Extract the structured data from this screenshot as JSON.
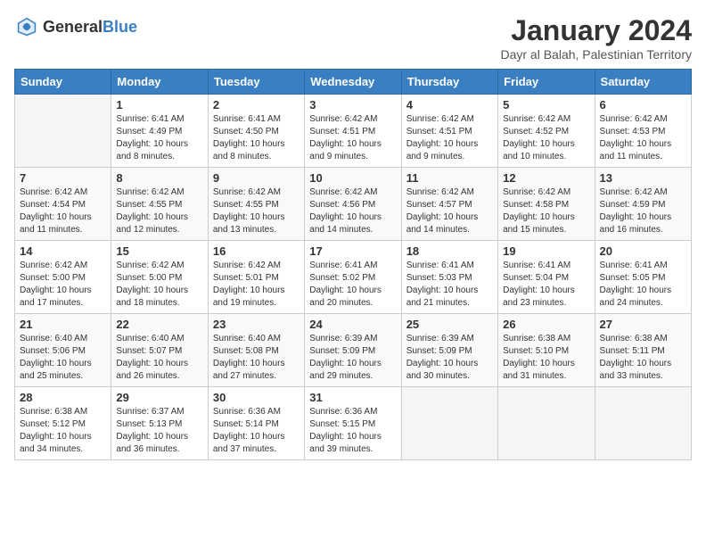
{
  "header": {
    "logo_general": "General",
    "logo_blue": "Blue",
    "title": "January 2024",
    "location": "Dayr al Balah, Palestinian Territory"
  },
  "weekdays": [
    "Sunday",
    "Monday",
    "Tuesday",
    "Wednesday",
    "Thursday",
    "Friday",
    "Saturday"
  ],
  "weeks": [
    [
      {
        "day": "",
        "info": ""
      },
      {
        "day": "1",
        "info": "Sunrise: 6:41 AM\nSunset: 4:49 PM\nDaylight: 10 hours\nand 8 minutes."
      },
      {
        "day": "2",
        "info": "Sunrise: 6:41 AM\nSunset: 4:50 PM\nDaylight: 10 hours\nand 8 minutes."
      },
      {
        "day": "3",
        "info": "Sunrise: 6:42 AM\nSunset: 4:51 PM\nDaylight: 10 hours\nand 9 minutes."
      },
      {
        "day": "4",
        "info": "Sunrise: 6:42 AM\nSunset: 4:51 PM\nDaylight: 10 hours\nand 9 minutes."
      },
      {
        "day": "5",
        "info": "Sunrise: 6:42 AM\nSunset: 4:52 PM\nDaylight: 10 hours\nand 10 minutes."
      },
      {
        "day": "6",
        "info": "Sunrise: 6:42 AM\nSunset: 4:53 PM\nDaylight: 10 hours\nand 11 minutes."
      }
    ],
    [
      {
        "day": "7",
        "info": "Sunrise: 6:42 AM\nSunset: 4:54 PM\nDaylight: 10 hours\nand 11 minutes."
      },
      {
        "day": "8",
        "info": "Sunrise: 6:42 AM\nSunset: 4:55 PM\nDaylight: 10 hours\nand 12 minutes."
      },
      {
        "day": "9",
        "info": "Sunrise: 6:42 AM\nSunset: 4:55 PM\nDaylight: 10 hours\nand 13 minutes."
      },
      {
        "day": "10",
        "info": "Sunrise: 6:42 AM\nSunset: 4:56 PM\nDaylight: 10 hours\nand 14 minutes."
      },
      {
        "day": "11",
        "info": "Sunrise: 6:42 AM\nSunset: 4:57 PM\nDaylight: 10 hours\nand 14 minutes."
      },
      {
        "day": "12",
        "info": "Sunrise: 6:42 AM\nSunset: 4:58 PM\nDaylight: 10 hours\nand 15 minutes."
      },
      {
        "day": "13",
        "info": "Sunrise: 6:42 AM\nSunset: 4:59 PM\nDaylight: 10 hours\nand 16 minutes."
      }
    ],
    [
      {
        "day": "14",
        "info": "Sunrise: 6:42 AM\nSunset: 5:00 PM\nDaylight: 10 hours\nand 17 minutes."
      },
      {
        "day": "15",
        "info": "Sunrise: 6:42 AM\nSunset: 5:00 PM\nDaylight: 10 hours\nand 18 minutes."
      },
      {
        "day": "16",
        "info": "Sunrise: 6:42 AM\nSunset: 5:01 PM\nDaylight: 10 hours\nand 19 minutes."
      },
      {
        "day": "17",
        "info": "Sunrise: 6:41 AM\nSunset: 5:02 PM\nDaylight: 10 hours\nand 20 minutes."
      },
      {
        "day": "18",
        "info": "Sunrise: 6:41 AM\nSunset: 5:03 PM\nDaylight: 10 hours\nand 21 minutes."
      },
      {
        "day": "19",
        "info": "Sunrise: 6:41 AM\nSunset: 5:04 PM\nDaylight: 10 hours\nand 23 minutes."
      },
      {
        "day": "20",
        "info": "Sunrise: 6:41 AM\nSunset: 5:05 PM\nDaylight: 10 hours\nand 24 minutes."
      }
    ],
    [
      {
        "day": "21",
        "info": "Sunrise: 6:40 AM\nSunset: 5:06 PM\nDaylight: 10 hours\nand 25 minutes."
      },
      {
        "day": "22",
        "info": "Sunrise: 6:40 AM\nSunset: 5:07 PM\nDaylight: 10 hours\nand 26 minutes."
      },
      {
        "day": "23",
        "info": "Sunrise: 6:40 AM\nSunset: 5:08 PM\nDaylight: 10 hours\nand 27 minutes."
      },
      {
        "day": "24",
        "info": "Sunrise: 6:39 AM\nSunset: 5:09 PM\nDaylight: 10 hours\nand 29 minutes."
      },
      {
        "day": "25",
        "info": "Sunrise: 6:39 AM\nSunset: 5:09 PM\nDaylight: 10 hours\nand 30 minutes."
      },
      {
        "day": "26",
        "info": "Sunrise: 6:38 AM\nSunset: 5:10 PM\nDaylight: 10 hours\nand 31 minutes."
      },
      {
        "day": "27",
        "info": "Sunrise: 6:38 AM\nSunset: 5:11 PM\nDaylight: 10 hours\nand 33 minutes."
      }
    ],
    [
      {
        "day": "28",
        "info": "Sunrise: 6:38 AM\nSunset: 5:12 PM\nDaylight: 10 hours\nand 34 minutes."
      },
      {
        "day": "29",
        "info": "Sunrise: 6:37 AM\nSunset: 5:13 PM\nDaylight: 10 hours\nand 36 minutes."
      },
      {
        "day": "30",
        "info": "Sunrise: 6:36 AM\nSunset: 5:14 PM\nDaylight: 10 hours\nand 37 minutes."
      },
      {
        "day": "31",
        "info": "Sunrise: 6:36 AM\nSunset: 5:15 PM\nDaylight: 10 hours\nand 39 minutes."
      },
      {
        "day": "",
        "info": ""
      },
      {
        "day": "",
        "info": ""
      },
      {
        "day": "",
        "info": ""
      }
    ]
  ]
}
